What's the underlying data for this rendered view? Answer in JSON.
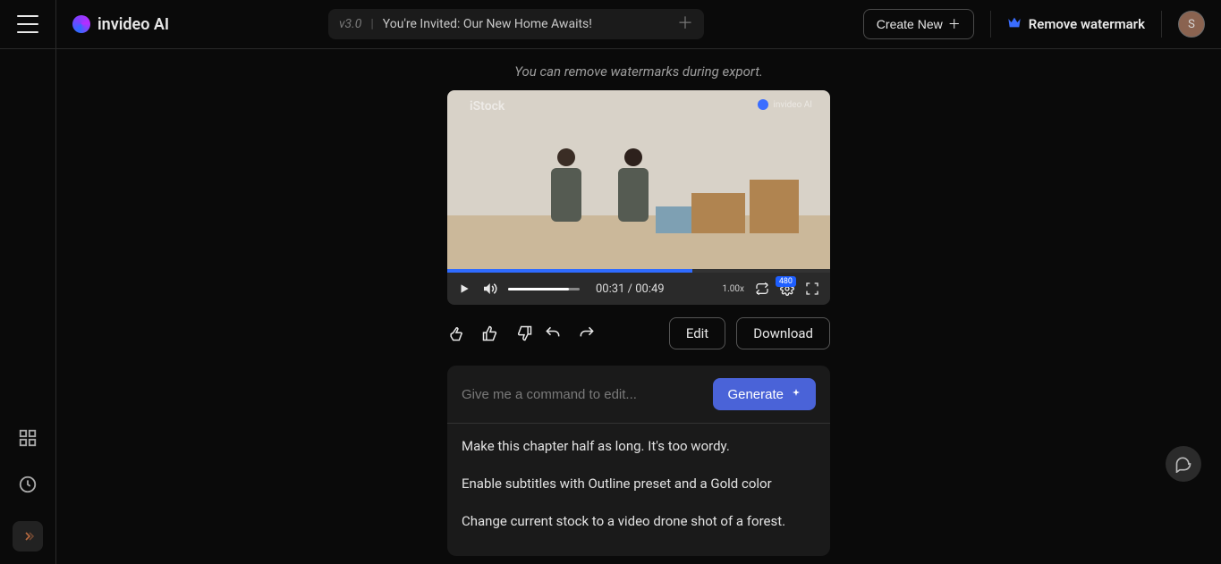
{
  "header": {
    "brand": "invideo AI",
    "version": "v3.0",
    "project_title": "You're Invited: Our New Home Awaits!",
    "create_new": "Create New",
    "remove_watermark": "Remove watermark",
    "avatar_initial": "S"
  },
  "main": {
    "export_note": "You can remove watermarks during export.",
    "watermark_stock": "iStock",
    "watermark_brand": "invideo AI"
  },
  "player": {
    "current_time": "00:31",
    "total_time": "00:49",
    "speed": "1.00x",
    "quality": "480"
  },
  "actions": {
    "edit": "Edit",
    "download": "Download"
  },
  "prompt": {
    "placeholder": "Give me a command to edit...",
    "generate": "Generate",
    "suggestions": [
      "Make this chapter half as long. It's too wordy.",
      "Enable subtitles with Outline preset and a Gold color",
      "Change current stock to a video drone shot of a forest."
    ]
  }
}
